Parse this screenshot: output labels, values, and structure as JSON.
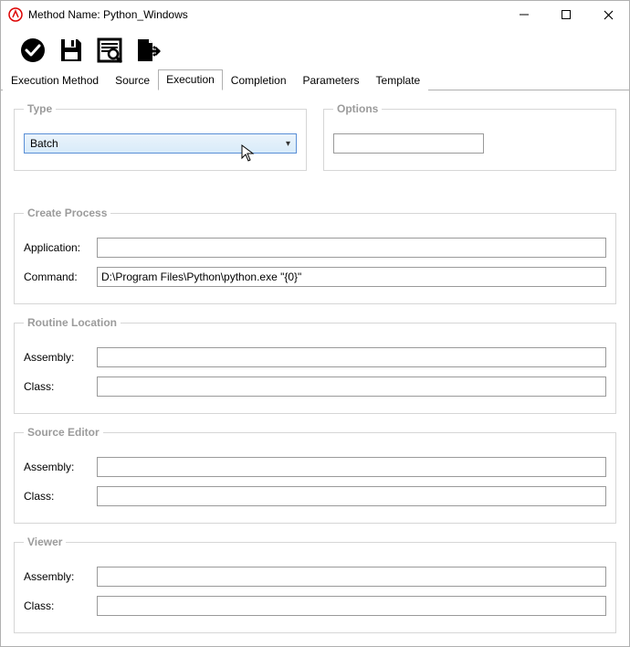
{
  "window": {
    "title": "Method Name: Python_Windows"
  },
  "tabs": {
    "t0": "Execution Method",
    "t1": "Source",
    "t2": "Execution",
    "t3": "Completion",
    "t4": "Parameters",
    "t5": "Template",
    "active_index": 2
  },
  "type_group": {
    "legend": "Type",
    "selected": "Batch"
  },
  "options_group": {
    "legend": "Options",
    "value": ""
  },
  "create_process": {
    "legend": "Create Process",
    "application_label": "Application:",
    "application_value": "",
    "command_label": "Command:",
    "command_value": "D:\\Program Files\\Python\\python.exe \"{0}\""
  },
  "routine_location": {
    "legend": "Routine Location",
    "assembly_label": "Assembly:",
    "assembly_value": "",
    "class_label": "Class:",
    "class_value": ""
  },
  "source_editor": {
    "legend": "Source Editor",
    "assembly_label": "Assembly:",
    "assembly_value": "",
    "class_label": "Class:",
    "class_value": ""
  },
  "viewer": {
    "legend": "Viewer",
    "assembly_label": "Assembly:",
    "assembly_value": "",
    "class_label": "Class:",
    "class_value": ""
  }
}
